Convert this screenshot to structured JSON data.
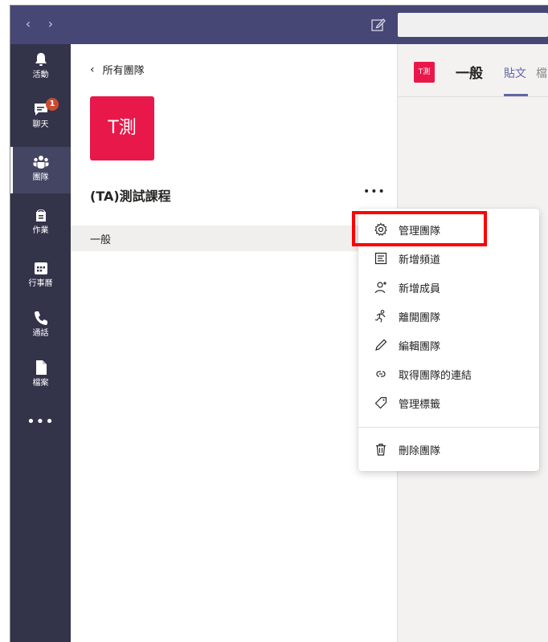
{
  "topbar": {
    "back_arrow": "‹",
    "forward_arrow": "›",
    "compose_icon": "compose-icon",
    "search_placeholder": ""
  },
  "rail": {
    "items": [
      {
        "label": "活動",
        "icon": "bell-icon"
      },
      {
        "label": "聊天",
        "icon": "chat-icon",
        "badge": "1"
      },
      {
        "label": "團隊",
        "icon": "teams-icon",
        "active": true
      },
      {
        "label": "作業",
        "icon": "assignments-icon"
      },
      {
        "label": "行事曆",
        "icon": "calendar-icon"
      },
      {
        "label": "通話",
        "icon": "phone-icon"
      },
      {
        "label": "檔案",
        "icon": "file-icon"
      }
    ],
    "more": "•••"
  },
  "panel": {
    "back_label": "所有團隊",
    "team_avatar_text": "T測",
    "team_name": "(TA)測試課程",
    "more": "•••",
    "channel": "一般"
  },
  "content": {
    "avatar_text": "T測",
    "title": "一般",
    "tab": "貼文",
    "tab_more": "檔"
  },
  "menu": {
    "items": [
      {
        "label": "管理團隊",
        "icon": "gear-icon"
      },
      {
        "label": "新增頻道",
        "icon": "channel-icon"
      },
      {
        "label": "新增成員",
        "icon": "add-member-icon"
      },
      {
        "label": "離開團隊",
        "icon": "leave-icon"
      },
      {
        "label": "編輯團隊",
        "icon": "pencil-icon"
      },
      {
        "label": "取得團隊的連結",
        "icon": "link-icon"
      },
      {
        "label": "管理標籤",
        "icon": "tag-icon"
      },
      {
        "label": "刪除團隊",
        "icon": "trash-icon"
      }
    ]
  },
  "colors": {
    "topbar": "#464775",
    "rail": "#33344a",
    "team_avatar": "#e8184b",
    "accent": "#6264a7",
    "highlight": "#ff0000",
    "badge": "#cc4a31"
  }
}
